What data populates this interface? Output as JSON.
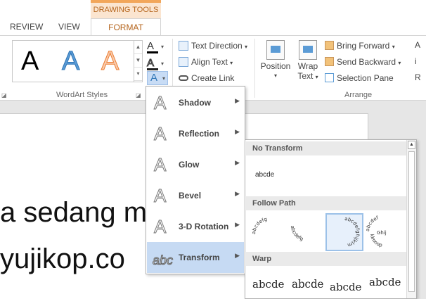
{
  "tabs": {
    "context_header": "DRAWING TOOLS",
    "review": "REVIEW",
    "view": "VIEW",
    "format": "FORMAT"
  },
  "wordart_styles": {
    "samples": [
      "A",
      "A",
      "A"
    ],
    "text_fill_glyph": "A",
    "text_outline_glyph": "A",
    "text_effects_glyph": "A",
    "group_label": "WordArt Styles",
    "colors": {
      "fill_bar": "#000000",
      "outline_bar": "#1f1f1f",
      "blue": "#5b9bd5",
      "orange": "#ed7d31"
    }
  },
  "text_group": {
    "text_direction": "Text Direction",
    "align_text": "Align Text",
    "create_link": "Create Link"
  },
  "arrange": {
    "position": "Position",
    "wrap_text_1": "Wrap",
    "wrap_text_2": "Text",
    "bring_forward": "Bring Forward",
    "send_backward": "Send Backward",
    "selection_pane": "Selection Pane",
    "group_label": "Arrange",
    "trim_top": "A",
    "trim_mid": "i",
    "trim_bottom": "R"
  },
  "document": {
    "line1": "a sedang me",
    "line2": "yujikop.co"
  },
  "effects_menu": {
    "items": [
      {
        "label": "Shadow",
        "glyph": "A"
      },
      {
        "label": "Reflection",
        "glyph": "A"
      },
      {
        "label": "Glow",
        "glyph": "A"
      },
      {
        "label": "Bevel",
        "glyph": "A"
      },
      {
        "label": "3-D Rotation",
        "glyph": "A"
      },
      {
        "label": "Transform",
        "glyph": "abc"
      }
    ]
  },
  "transform_menu": {
    "no_transform": "No Transform",
    "no_transform_sample": "abcde",
    "follow_path": "Follow Path",
    "warp": "Warp",
    "warp_sample": "abcde",
    "follow_samples": {
      "arch_up": "abcdefg",
      "arch_down": "abcdefg",
      "circle": "abcdefghijklm",
      "button_top": "abcdef",
      "button_mid": "Ghij",
      "button_bottom": "klmnop"
    }
  }
}
